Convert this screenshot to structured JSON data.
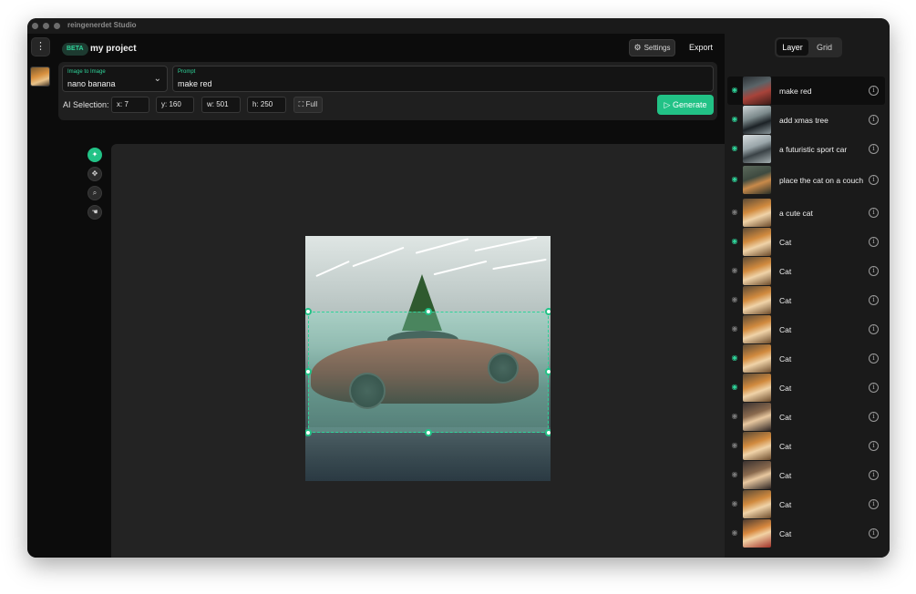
{
  "app": {
    "title": "reingenerdet Studio"
  },
  "header": {
    "beta": "BETA",
    "project_name": "my project",
    "settings_label": "Settings",
    "export_label": "Export"
  },
  "model": {
    "label": "Image to Image",
    "value": "nano banana"
  },
  "prompt": {
    "label": "Prompt",
    "value": "make red"
  },
  "selection": {
    "label": "AI Selection:",
    "x": "x: 7",
    "y": "y: 160",
    "w": "w: 501",
    "h": "h: 250",
    "full_label": "Full"
  },
  "generate": {
    "label": "Generate"
  },
  "tools": [
    "ai-select",
    "move",
    "zoom",
    "pan"
  ],
  "panel": {
    "tabs": [
      {
        "label": "Layer",
        "active": true
      },
      {
        "label": "Grid",
        "active": false
      }
    ],
    "layers": [
      {
        "label": "make red",
        "visible": true,
        "selected": true,
        "thumb": "red-car"
      },
      {
        "label": "add xmas tree",
        "visible": true,
        "selected": false,
        "thumb": "dark-car"
      },
      {
        "label": "a futuristic sport car",
        "visible": true,
        "selected": false,
        "thumb": "silver-car"
      },
      {
        "label": "place the cat on a couch",
        "visible": true,
        "selected": false,
        "thumb": "couch-cat"
      },
      {
        "label": "a cute cat",
        "visible": false,
        "selected": false,
        "thumb": "cat"
      },
      {
        "label": "Cat",
        "visible": true,
        "selected": false,
        "thumb": "cat"
      },
      {
        "label": "Cat",
        "visible": false,
        "selected": false,
        "thumb": "cat"
      },
      {
        "label": "Cat",
        "visible": false,
        "selected": false,
        "thumb": "cat"
      },
      {
        "label": "Cat",
        "visible": false,
        "selected": false,
        "thumb": "cat"
      },
      {
        "label": "Cat",
        "visible": true,
        "selected": false,
        "thumb": "cat"
      },
      {
        "label": "Cat",
        "visible": true,
        "selected": false,
        "thumb": "cat"
      },
      {
        "label": "Cat",
        "visible": false,
        "selected": false,
        "thumb": "cat-dark"
      },
      {
        "label": "Cat",
        "visible": false,
        "selected": false,
        "thumb": "cat"
      },
      {
        "label": "Cat",
        "visible": false,
        "selected": false,
        "thumb": "cat-dark"
      },
      {
        "label": "Cat",
        "visible": false,
        "selected": false,
        "thumb": "cat"
      },
      {
        "label": "Cat",
        "visible": false,
        "selected": false,
        "thumb": "cat-red"
      }
    ]
  },
  "colors": {
    "accent": "#22c286",
    "accent_text": "#2fd49a",
    "background": "#0f0f0f",
    "canvas": "#232323"
  }
}
